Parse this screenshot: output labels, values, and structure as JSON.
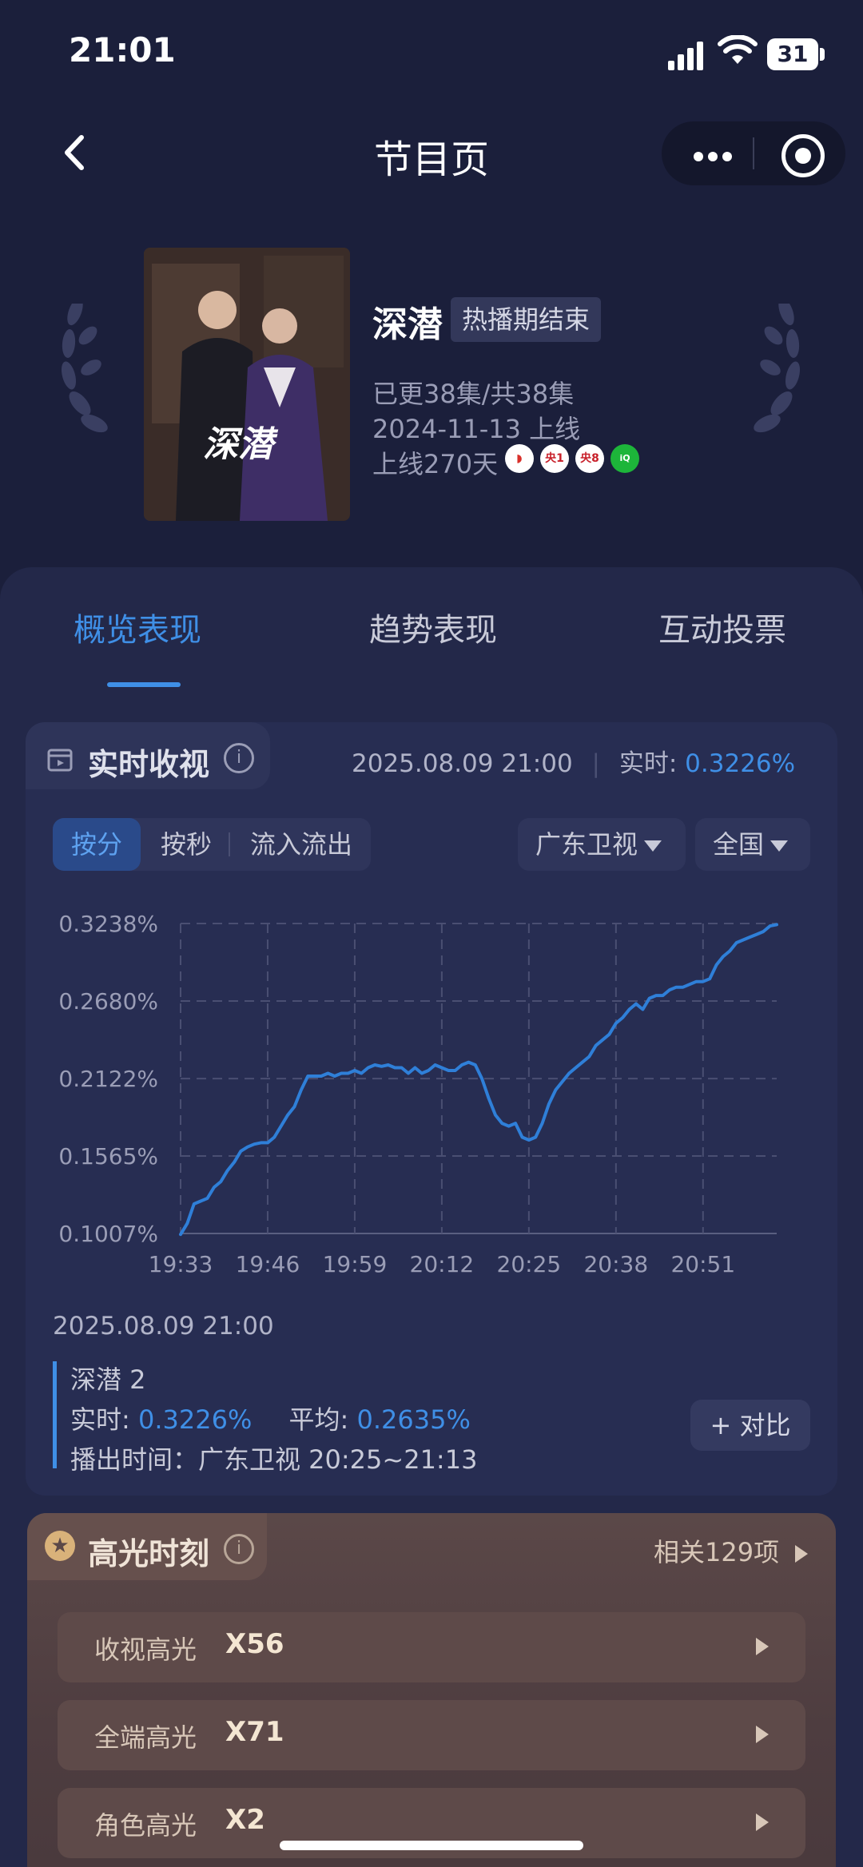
{
  "status_bar": {
    "time": "21:01",
    "battery": "31"
  },
  "nav": {
    "title": "节目页"
  },
  "show": {
    "title": "深潜",
    "status_tag": "热播期结束",
    "poster_text": "深潜",
    "episodes": "已更38集/共38集",
    "premiere": "2024-11-13 上线",
    "online_days": "上线270天",
    "platforms": [
      "广东卫视",
      "央1",
      "央8",
      "爱奇艺"
    ]
  },
  "tabs": [
    {
      "label": "概览表现",
      "active": true
    },
    {
      "label": "趋势表现",
      "active": false
    },
    {
      "label": "互动投票",
      "active": false
    }
  ],
  "realtime": {
    "title": "实时收视",
    "timestamp": "2025.08.09 21:00",
    "rating_prefix": "实时:",
    "rating_value": "0.3226%",
    "segments": [
      "按分",
      "按秒",
      "流入流出"
    ],
    "channel": "广东卫视",
    "region": "全国"
  },
  "chart_data": {
    "type": "line",
    "x_ticks": [
      "19:33",
      "19:46",
      "19:59",
      "20:12",
      "20:25",
      "20:38",
      "20:51"
    ],
    "y_ticks": [
      "0.3238%",
      "0.2680%",
      "0.2122%",
      "0.1565%",
      "0.1007%"
    ],
    "ylim": [
      0.1007,
      0.3238
    ],
    "grid": true,
    "series": [
      {
        "x": [
          "19:33",
          "19:34",
          "19:35",
          "19:36",
          "19:37",
          "19:38",
          "19:39",
          "19:40",
          "19:41",
          "19:42",
          "19:43",
          "19:44",
          "19:45",
          "19:46",
          "19:47",
          "19:48",
          "19:49",
          "19:50",
          "19:51",
          "19:52",
          "19:53",
          "19:54",
          "19:55",
          "19:56",
          "19:57",
          "19:58",
          "19:59",
          "20:00",
          "20:01",
          "20:02",
          "20:03",
          "20:04",
          "20:05",
          "20:06",
          "20:07",
          "20:08",
          "20:09",
          "20:10",
          "20:11",
          "20:12",
          "20:13",
          "20:14",
          "20:15",
          "20:16",
          "20:17",
          "20:18",
          "20:19",
          "20:20",
          "20:21",
          "20:22",
          "20:23",
          "20:24",
          "20:25",
          "20:26",
          "20:27",
          "20:28",
          "20:29",
          "20:30",
          "20:31",
          "20:32",
          "20:33",
          "20:34",
          "20:35",
          "20:36",
          "20:37",
          "20:38",
          "20:39",
          "20:40",
          "20:41",
          "20:42",
          "20:43",
          "20:44",
          "20:45",
          "20:46",
          "20:47",
          "20:48",
          "20:49",
          "20:50",
          "20:51",
          "20:52",
          "20:53",
          "20:54",
          "20:55",
          "20:56",
          "20:57",
          "20:58",
          "20:59",
          "21:00",
          "21:01",
          "21:02"
        ],
        "values": [
          0.1,
          0.108,
          0.122,
          0.124,
          0.126,
          0.134,
          0.138,
          0.146,
          0.152,
          0.16,
          0.163,
          0.165,
          0.166,
          0.166,
          0.17,
          0.178,
          0.186,
          0.192,
          0.204,
          0.214,
          0.214,
          0.214,
          0.216,
          0.214,
          0.216,
          0.216,
          0.218,
          0.216,
          0.22,
          0.222,
          0.221,
          0.222,
          0.22,
          0.22,
          0.216,
          0.22,
          0.216,
          0.218,
          0.222,
          0.22,
          0.218,
          0.218,
          0.222,
          0.224,
          0.222,
          0.212,
          0.198,
          0.186,
          0.18,
          0.178,
          0.18,
          0.17,
          0.168,
          0.17,
          0.18,
          0.194,
          0.204,
          0.21,
          0.216,
          0.22,
          0.224,
          0.228,
          0.236,
          0.24,
          0.244,
          0.252,
          0.256,
          0.262,
          0.266,
          0.262,
          0.27,
          0.272,
          0.272,
          0.276,
          0.278,
          0.278,
          0.28,
          0.282,
          0.282,
          0.284,
          0.294,
          0.3,
          0.304,
          0.31,
          0.312,
          0.314,
          0.316,
          0.318,
          0.322,
          0.323
        ]
      }
    ]
  },
  "detail": {
    "timestamp": "2025.08.09 21:00",
    "program": "深潜 2",
    "rt_label": "实时:",
    "rt_value": "0.3226%",
    "avg_label": "平均:",
    "avg_value": "0.2635%",
    "airtime": "播出时间：广东卫视 20:25~21:13",
    "compare_label": "+ 对比"
  },
  "highlights": {
    "title": "高光时刻",
    "related": "相关129项",
    "items": [
      {
        "label": "收视高光",
        "count": "X56"
      },
      {
        "label": "全端高光",
        "count": "X71"
      },
      {
        "label": "角色高光",
        "count": "X2"
      }
    ]
  },
  "colors": {
    "accent": "#3f8fe6",
    "background": "#1b1f3b",
    "card": "#272d52",
    "highlight_card": "#5b4848"
  }
}
